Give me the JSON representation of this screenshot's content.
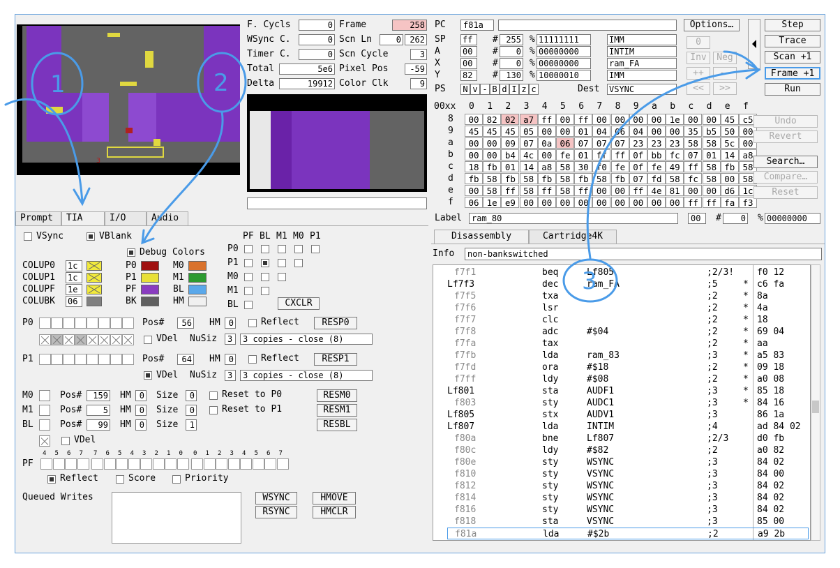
{
  "counters": {
    "f_cycls_label": "F. Cycls",
    "f_cycls": "0",
    "wsync_label": "WSync C.",
    "wsync": "0",
    "timer_label": "Timer C.",
    "timer": "0",
    "total_label": "Total",
    "total": "5e6",
    "delta_label": "Delta",
    "delta": "19912",
    "frame_label": "Frame",
    "frame": "258",
    "scnln_label": "Scn Ln",
    "scnln_a": "0",
    "scnln_b": "262",
    "scncycle_label": "Scn Cycle",
    "scncycle": "3",
    "pixelpos_label": "Pixel Pos",
    "pixelpos": "-59",
    "colorclk_label": "Color Clk",
    "colorclk": "9"
  },
  "cpu": {
    "pc_label": "PC",
    "pc": "f81a",
    "sp_label": "SP",
    "sp": "ff",
    "sp_dec": "255",
    "sp_bin": "11111111",
    "sp_mode": "IMM",
    "a_label": "A",
    "a": "00",
    "a_dec": "0",
    "a_bin": "00000000",
    "a_mode": "INTIM",
    "x_label": "X",
    "x": "00",
    "x_dec": "0",
    "x_bin": "00000000",
    "x_mode": "ram_FA",
    "y_label": "Y",
    "y": "82",
    "y_dec": "130",
    "y_bin": "10000010",
    "y_mode": "IMM",
    "ps_label": "PS",
    "ps_flags": [
      "N",
      "v",
      "-",
      "B",
      "d",
      "I",
      "z",
      "c"
    ],
    "dest_label": "Dest",
    "dest": "VSYNC",
    "hash": "#",
    "pct": "%"
  },
  "buttons": {
    "options": "Options…",
    "step": "Step",
    "trace": "Trace",
    "scan": "Scan +1",
    "frame": "Frame +1",
    "run": "Run",
    "zero": "0",
    "inv": "Inv",
    "neg": "Neg",
    "inc": "++",
    "dec": "--",
    "shl": "<<",
    "shr": ">>",
    "undo": "Undo",
    "revert": "Revert",
    "search": "Search…",
    "compare": "Compare…",
    "reset": "Reset"
  },
  "ram": {
    "header": [
      "00xx",
      "0",
      "1",
      "2",
      "3",
      "4",
      "5",
      "6",
      "7",
      "8",
      "9",
      "a",
      "b",
      "c",
      "d",
      "e",
      "f"
    ],
    "rows": [
      {
        "addr": "8",
        "cells": [
          "00",
          "82",
          "02",
          "a7",
          "ff",
          "00",
          "ff",
          "00",
          "00",
          "00",
          "00",
          "1e",
          "00",
          "00",
          "45",
          "c5"
        ]
      },
      {
        "addr": "9",
        "cells": [
          "45",
          "45",
          "45",
          "05",
          "00",
          "00",
          "01",
          "04",
          "06",
          "04",
          "00",
          "00",
          "35",
          "b5",
          "50",
          "00"
        ]
      },
      {
        "addr": "a",
        "cells": [
          "00",
          "00",
          "09",
          "07",
          "0a",
          "06",
          "07",
          "07",
          "07",
          "23",
          "23",
          "23",
          "58",
          "58",
          "5c",
          "00"
        ]
      },
      {
        "addr": "b",
        "cells": [
          "00",
          "00",
          "b4",
          "4c",
          "00",
          "fe",
          "01",
          "ff",
          "ff",
          "0f",
          "bb",
          "fc",
          "07",
          "01",
          "14",
          "a8"
        ]
      },
      {
        "addr": "c",
        "cells": [
          "18",
          "fb",
          "01",
          "14",
          "a8",
          "58",
          "30",
          "f0",
          "fe",
          "0f",
          "fe",
          "49",
          "ff",
          "58",
          "fb",
          "58"
        ]
      },
      {
        "addr": "d",
        "cells": [
          "fb",
          "58",
          "fb",
          "58",
          "fb",
          "58",
          "fb",
          "58",
          "fb",
          "07",
          "fd",
          "58",
          "fc",
          "58",
          "00",
          "58"
        ]
      },
      {
        "addr": "e",
        "cells": [
          "00",
          "58",
          "ff",
          "58",
          "ff",
          "58",
          "ff",
          "00",
          "00",
          "ff",
          "4e",
          "81",
          "00",
          "00",
          "d6",
          "1c"
        ]
      },
      {
        "addr": "f",
        "cells": [
          "06",
          "1e",
          "e9",
          "00",
          "00",
          "00",
          "00",
          "00",
          "00",
          "00",
          "00",
          "00",
          "ff",
          "ff",
          "fa",
          "f3"
        ]
      }
    ],
    "label_label": "Label",
    "label": "ram_80",
    "val_hex": "00",
    "val_dec": "0",
    "val_bin": "00000000"
  },
  "tabs_right": [
    "Disassembly",
    "Cartridge4K"
  ],
  "info_label": "Info",
  "info": "non-bankswitched",
  "disasm": [
    {
      "addr": "f7f1",
      "label": "",
      "op": "beq",
      "arg": "Lf805",
      "cyc": ";2/3!",
      "mark": "",
      "bytes": "f0 12"
    },
    {
      "addr": "",
      "label": "Lf7f3",
      "op": "dec",
      "arg": "ram_FA",
      "cyc": ";5",
      "mark": "*",
      "bytes": "c6 fa"
    },
    {
      "addr": "f7f5",
      "label": "",
      "op": "txa",
      "arg": "",
      "cyc": ";2",
      "mark": "*",
      "bytes": "8a"
    },
    {
      "addr": "f7f6",
      "label": "",
      "op": "lsr",
      "arg": "",
      "cyc": ";2",
      "mark": "*",
      "bytes": "4a"
    },
    {
      "addr": "f7f7",
      "label": "",
      "op": "clc",
      "arg": "",
      "cyc": ";2",
      "mark": "*",
      "bytes": "18"
    },
    {
      "addr": "f7f8",
      "label": "",
      "op": "adc",
      "arg": "#$04",
      "cyc": ";2",
      "mark": "*",
      "bytes": "69 04"
    },
    {
      "addr": "f7fa",
      "label": "",
      "op": "tax",
      "arg": "",
      "cyc": ";2",
      "mark": "*",
      "bytes": "aa"
    },
    {
      "addr": "f7fb",
      "label": "",
      "op": "lda",
      "arg": "ram_83",
      "cyc": ";3",
      "mark": "*",
      "bytes": "a5 83"
    },
    {
      "addr": "f7fd",
      "label": "",
      "op": "ora",
      "arg": "#$18",
      "cyc": ";2",
      "mark": "*",
      "bytes": "09 18"
    },
    {
      "addr": "f7ff",
      "label": "",
      "op": "ldy",
      "arg": "#$08",
      "cyc": ";2",
      "mark": "*",
      "bytes": "a0 08"
    },
    {
      "addr": "",
      "label": "Lf801",
      "op": "sta",
      "arg": "AUDF1",
      "cyc": ";3",
      "mark": "*",
      "bytes": "85 18"
    },
    {
      "addr": "f803",
      "label": "",
      "op": "sty",
      "arg": "AUDC1",
      "cyc": ";3",
      "mark": "*",
      "bytes": "84 16"
    },
    {
      "addr": "",
      "label": "Lf805",
      "op": "stx",
      "arg": "AUDV1",
      "cyc": ";3",
      "mark": "",
      "bytes": "86 1a"
    },
    {
      "addr": "",
      "label": "Lf807",
      "op": "lda",
      "arg": "INTIM",
      "cyc": ";4",
      "mark": "",
      "bytes": "ad 84 02"
    },
    {
      "addr": "f80a",
      "label": "",
      "op": "bne",
      "arg": "Lf807",
      "cyc": ";2/3",
      "mark": "",
      "bytes": "d0 fb"
    },
    {
      "addr": "f80c",
      "label": "",
      "op": "ldy",
      "arg": "#$82",
      "cyc": ";2",
      "mark": "",
      "bytes": "a0 82"
    },
    {
      "addr": "f80e",
      "label": "",
      "op": "sty",
      "arg": "WSYNC",
      "cyc": ";3",
      "mark": "",
      "bytes": "84 02"
    },
    {
      "addr": "f810",
      "label": "",
      "op": "sty",
      "arg": "VSYNC",
      "cyc": ";3",
      "mark": "",
      "bytes": "84 00"
    },
    {
      "addr": "f812",
      "label": "",
      "op": "sty",
      "arg": "WSYNC",
      "cyc": ";3",
      "mark": "",
      "bytes": "84 02"
    },
    {
      "addr": "f814",
      "label": "",
      "op": "sty",
      "arg": "WSYNC",
      "cyc": ";3",
      "mark": "",
      "bytes": "84 02"
    },
    {
      "addr": "f816",
      "label": "",
      "op": "sty",
      "arg": "WSYNC",
      "cyc": ";3",
      "mark": "",
      "bytes": "84 02"
    },
    {
      "addr": "f818",
      "label": "",
      "op": "sta",
      "arg": "VSYNC",
      "cyc": ";3",
      "mark": "",
      "bytes": "85 00"
    },
    {
      "addr": "f81a",
      "label": "",
      "op": "lda",
      "arg": "#$2b",
      "cyc": ";2",
      "mark": "",
      "bytes": "a9 2b"
    }
  ],
  "tabs_left": [
    "Prompt",
    "TIA",
    "I/O",
    "Audio"
  ],
  "tia": {
    "vsync": "VSync",
    "vblank": "VBlank",
    "debug_colors": "Debug Colors",
    "colu": [
      {
        "name": "COLUP0",
        "val": "1c"
      },
      {
        "name": "COLUP1",
        "val": "1c"
      },
      {
        "name": "COLUPF",
        "val": "1e"
      },
      {
        "name": "COLUBK",
        "val": "06"
      }
    ],
    "dbg": [
      {
        "name": "P0",
        "color": "#a01010"
      },
      {
        "name": "M0",
        "color": "#d9722c"
      },
      {
        "name": "P1",
        "color": "#e8e038"
      },
      {
        "name": "M1",
        "color": "#2c9a30"
      },
      {
        "name": "PF",
        "color": "#8a3cc0"
      },
      {
        "name": "BL",
        "color": "#5aa8ea"
      },
      {
        "name": "BK",
        "color": "#606060"
      },
      {
        "name": "HM",
        "color": "#f0f0f0"
      }
    ],
    "coll_cols": [
      "PF",
      "BL",
      "M1",
      "M0",
      "P1"
    ],
    "coll_rows": [
      "P0",
      "P1",
      "M0",
      "M1",
      "BL"
    ],
    "cxclr": "CXCLR",
    "p0_label": "P0",
    "p1_label": "P1",
    "pos_label": "Pos#",
    "hm_label": "HM",
    "reflect": "Reflect",
    "vdel": "VDel",
    "nusiz_label": "NuSiz",
    "p0_pos": "56",
    "p0_hm": "0",
    "p0_nusiz": "3",
    "p0_nusiz_txt": "3 copies - close (8)",
    "resp0": "RESP0",
    "p1_pos": "64",
    "p1_hm": "0",
    "p1_nusiz": "3",
    "p1_nusiz_txt": "3 copies - close (8)",
    "resp1": "RESP1",
    "size_label": "Size",
    "m0_label": "M0",
    "m0_pos": "159",
    "m0_hm": "0",
    "m0_size": "0",
    "reset_p0": "Reset to P0",
    "resm0": "RESM0",
    "m1_label": "M1",
    "m1_pos": "5",
    "m1_hm": "0",
    "m1_size": "0",
    "reset_p1": "Reset to P1",
    "resm1": "RESM1",
    "bl_label": "BL",
    "bl_pos": "99",
    "bl_hm": "0",
    "bl_size": "1",
    "resbl": "RESBL",
    "pf_label": "PF",
    "pf_bits": [
      "4",
      "5",
      "6",
      "7",
      "7",
      "6",
      "5",
      "4",
      "3",
      "2",
      "1",
      "0",
      "0",
      "1",
      "2",
      "3",
      "4",
      "5",
      "6",
      "7"
    ],
    "pf_reflect": "Reflect",
    "score": "Score",
    "priority": "Priority",
    "queued": "Queued Writes",
    "wsync": "WSYNC",
    "rsync": "RSYNC",
    "hmove": "HMOVE",
    "hmclr": "HMCLR"
  },
  "annotations": [
    "1",
    "2",
    "3"
  ],
  "colors": {
    "accent": "#4a9be8",
    "highlight": "#f6c4c4",
    "purple": "#7a2fb0"
  }
}
